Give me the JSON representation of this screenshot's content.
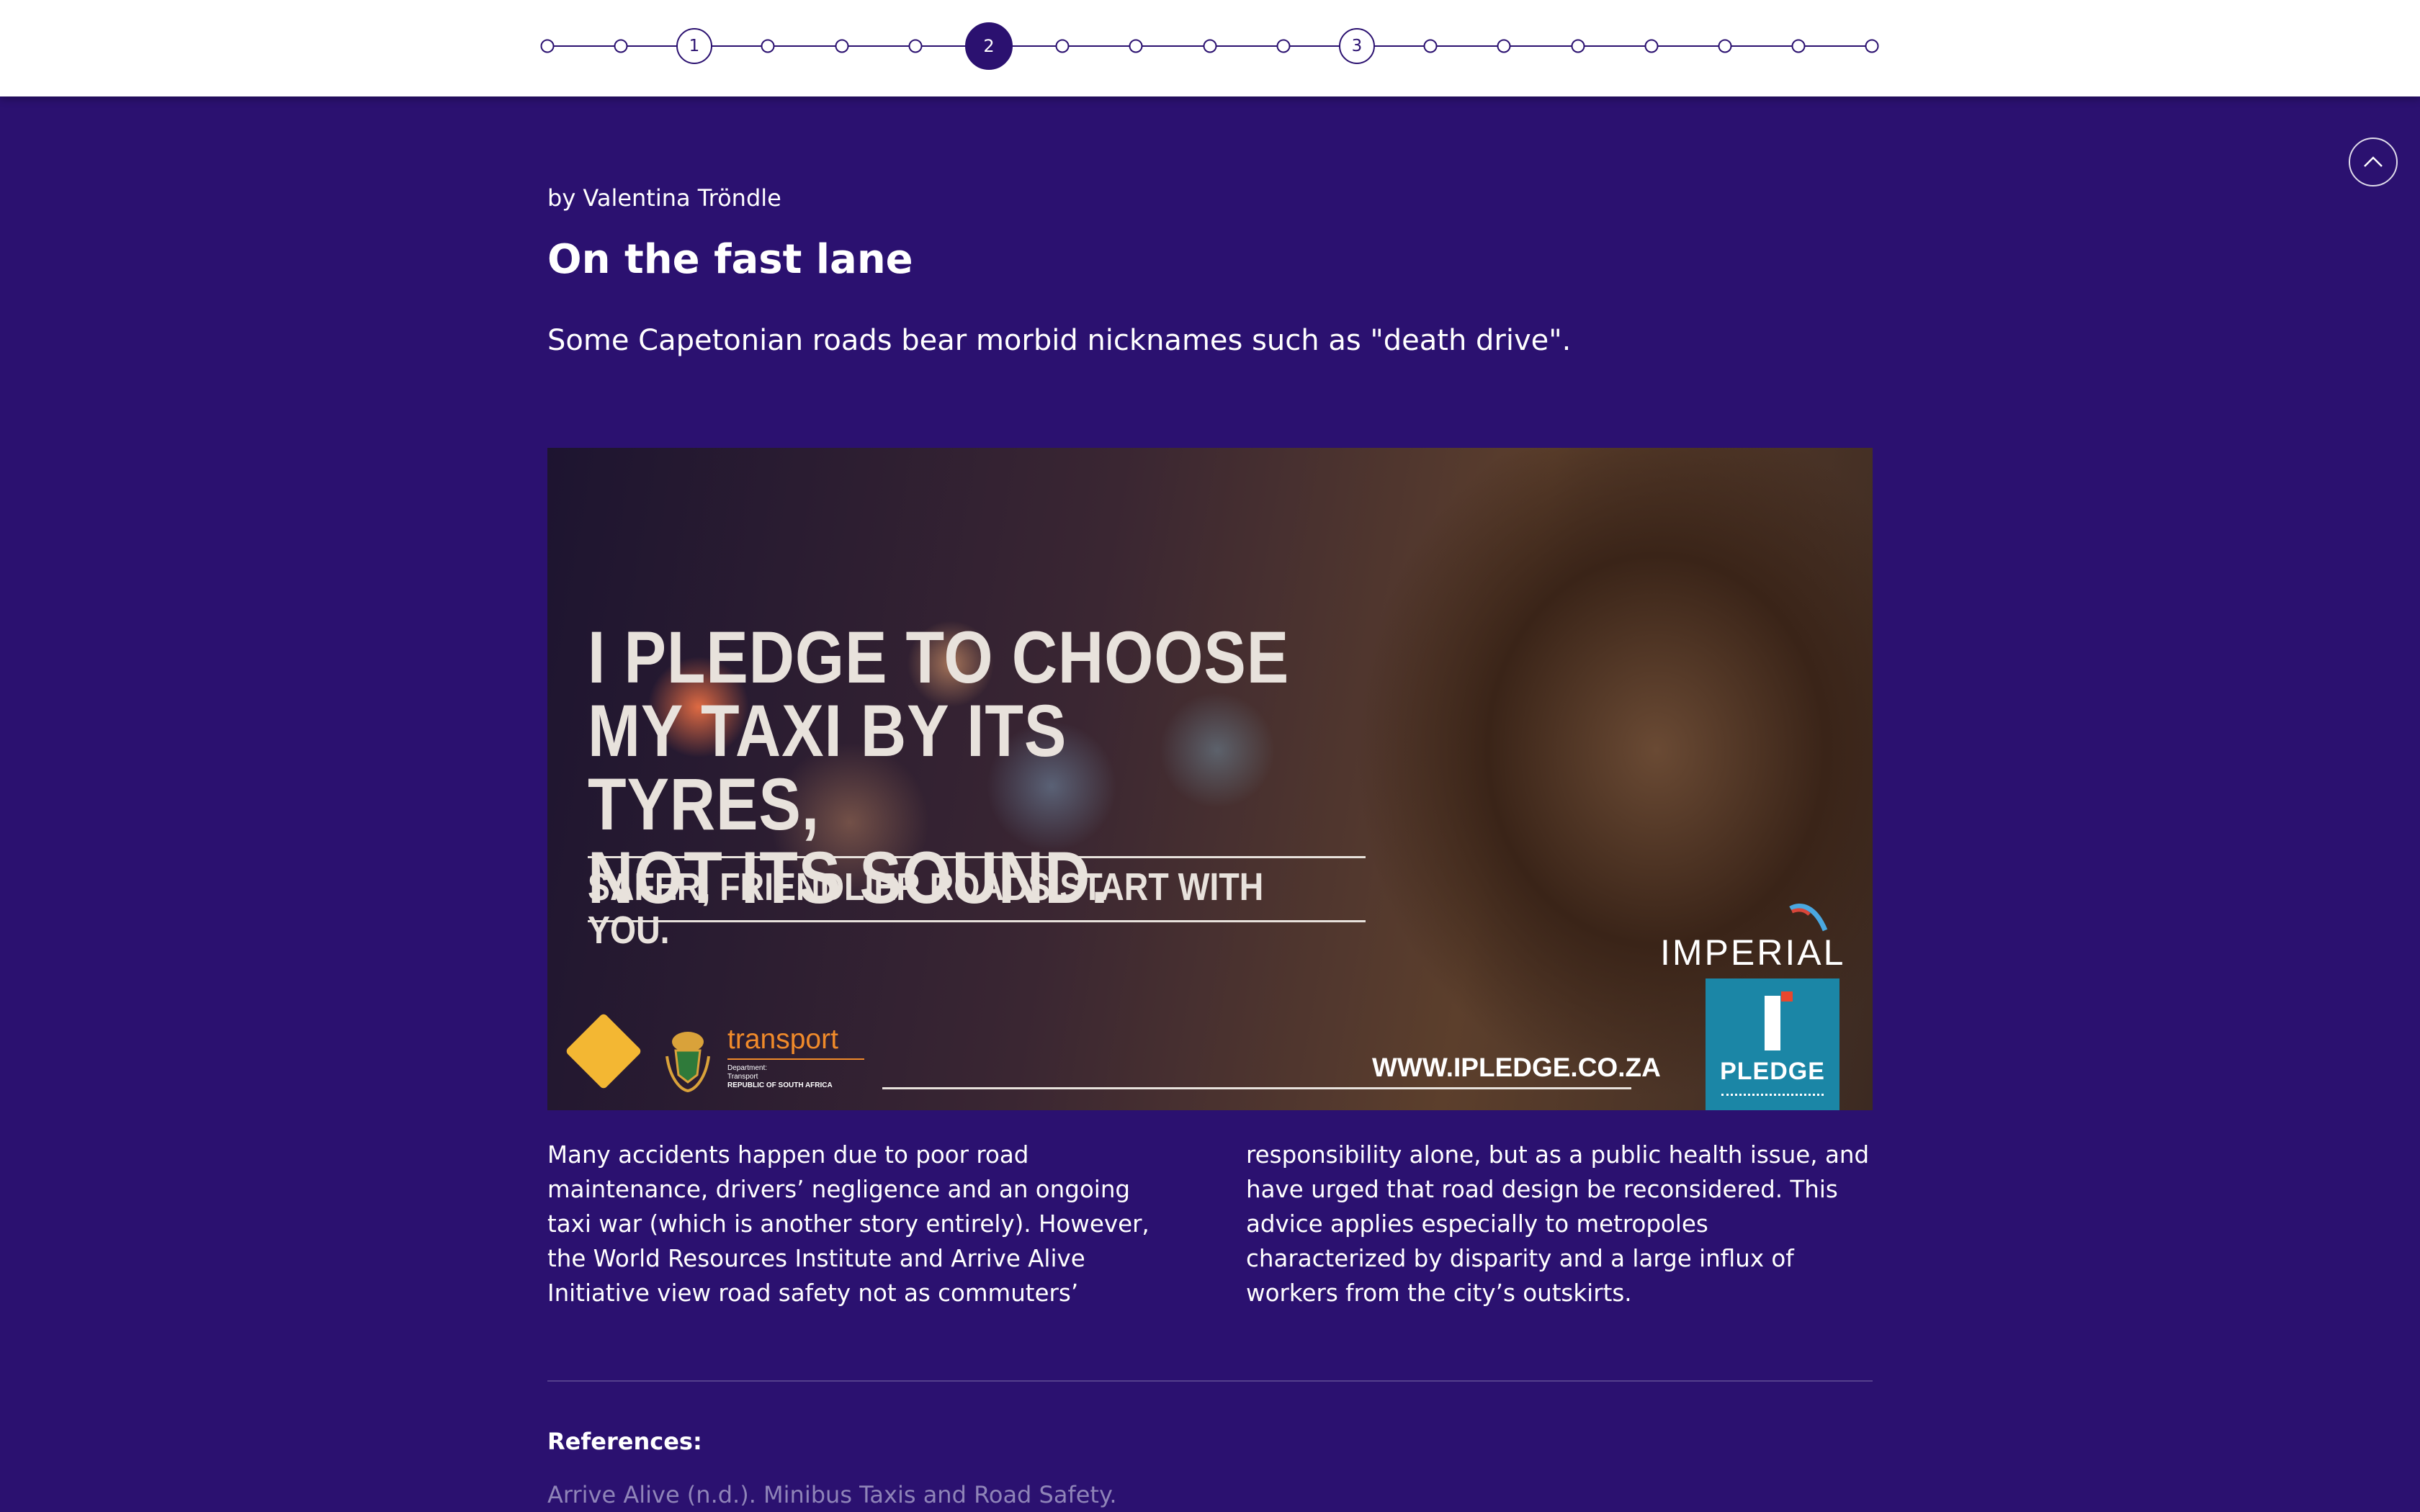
{
  "progress": {
    "numbered_steps": [
      "1",
      "2",
      "3"
    ],
    "active_step": "2",
    "total_steps": 19
  },
  "article": {
    "byline": "by Valentina Tröndle",
    "title": "On the fast lane",
    "lead": "Some Capetonian roads bear morbid nicknames such as \"death drive\".",
    "image": {
      "headline_lines": [
        "I PLEDGE TO CHOOSE",
        "MY TAXI BY ITS TYRES,",
        "NOT ITS SOUND."
      ],
      "subline": "SAFER, FRIENDLIER ROADS START WITH YOU.",
      "url": "WWW.IPLEDGE.CO.ZA",
      "brand": "IMPERIAL",
      "pledge_label": "PLEDGE",
      "transport_label": "transport",
      "transport_fine_1": "Department:",
      "transport_fine_2": "Transport",
      "transport_fine_3": "REPUBLIC OF SOUTH AFRICA"
    },
    "body_col_1": "Many accidents happen due to poor road maintenance, drivers’ negligence and an ongoing taxi war (which is another story entirely). However, the World Resources Institute and Arrive Alive Initiative view road safety not as commuters’",
    "body_col_2": "responsibility alone, but as a public health issue, and have urged that road design be reconsidered. This advice applies especially to metropoles characterized by disparity and a large influx of workers from the city’s outskirts.",
    "references_heading": "References:",
    "references": [
      "Arrive Alive (n.d.). Minibus Taxis and Road Safety."
    ]
  },
  "icons": {
    "scroll_top": "chevron-up-icon"
  },
  "colors": {
    "background": "#2b1170",
    "accent": "#2b1170",
    "reference_text": "#8f84b8"
  }
}
